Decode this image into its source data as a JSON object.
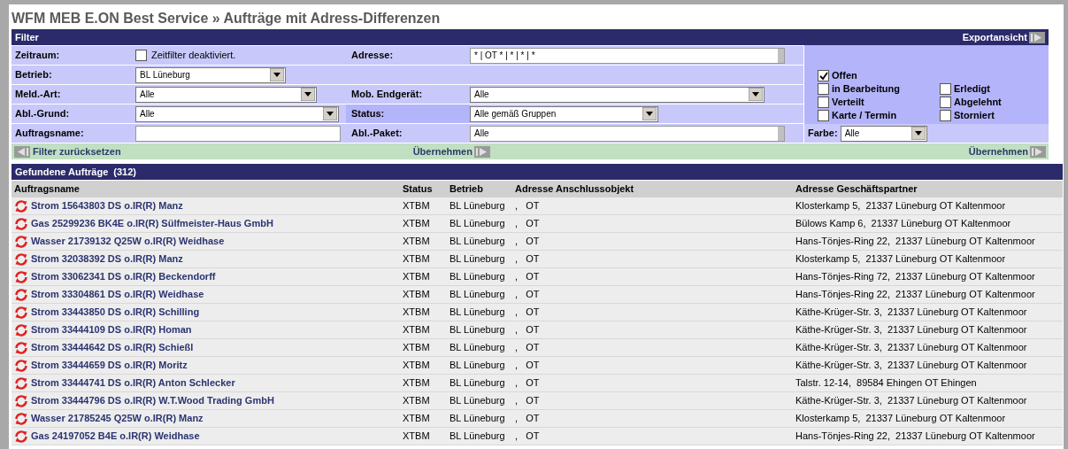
{
  "title": "WFM MEB E.ON Best Service » Aufträge mit Adress-Differenzen",
  "filter": {
    "heading": "Filter",
    "export_link": "Exportansicht",
    "rows": [
      {
        "label": "Zeitraum:",
        "control": {
          "kind": "checkbox",
          "checked": false,
          "label": "Zeitfilter deaktiviert."
        },
        "label2": "Adresse:",
        "control2": {
          "kind": "textarea",
          "value": "* | OT * | * | * | *"
        }
      },
      {
        "label": "Betrieb:",
        "control": {
          "kind": "select",
          "value": "BL Lüneburg"
        }
      },
      {
        "label": "Meld.-Art:",
        "control": {
          "kind": "select",
          "value": "Alle"
        },
        "label2": "Mob. Endgerät:",
        "control2": {
          "kind": "select",
          "value": "Alle"
        }
      },
      {
        "label": "Abl.-Grund:",
        "control": {
          "kind": "select",
          "value": "Alle"
        },
        "label2": "Status:",
        "control2": {
          "kind": "select",
          "value": "Alle gemäß Gruppen"
        }
      },
      {
        "label": "Auftragsname:",
        "control": {
          "kind": "text"
        },
        "label2": "Abl.-Paket:",
        "control2": {
          "kind": "textarea",
          "value": "Alle"
        }
      }
    ],
    "status_columns": [
      [
        {
          "label": "Offen",
          "checked": true
        },
        {
          "label": "in Bearbeitung",
          "checked": false
        },
        {
          "label": "Verteilt",
          "checked": false
        },
        {
          "label": "Karte / Termin",
          "checked": false
        }
      ],
      [
        {
          "label": "Erledigt",
          "checked": false
        },
        {
          "label": "Abgelehnt",
          "checked": false
        },
        {
          "label": "Storniert",
          "checked": false
        }
      ]
    ],
    "color_filter": {
      "label": "Farbe:",
      "value": "Alle"
    },
    "actions": {
      "reset": "Filter zurücksetzen",
      "apply": "Übernehmen",
      "apply_right": "Übernehmen"
    }
  },
  "results": {
    "heading": "Gefundene Aufträge",
    "count": "(312)",
    "columns": [
      "Auftragsname",
      "Status",
      "Betrieb",
      "Adresse Anschlussobjekt",
      "Adresse Geschäftspartner"
    ],
    "rows": [
      {
        "name": "Strom 15643803 DS o.IR(R) Manz",
        "status": "XTBM",
        "betrieb": "BL Lüneburg",
        "object": ",   OT",
        "partner": "Klosterkamp 5,  21337 Lüneburg OT Kaltenmoor"
      },
      {
        "name": "Gas 25299236 BK4E o.IR(R) Sülfmeister-Haus GmbH",
        "status": "XTBM",
        "betrieb": "BL Lüneburg",
        "object": ",   OT",
        "partner": "Bülows Kamp 6,  21337 Lüneburg OT Kaltenmoor"
      },
      {
        "name": "Wasser 21739132 Q25W o.IR(R) Weidhase",
        "status": "XTBM",
        "betrieb": "BL Lüneburg",
        "object": ",   OT",
        "partner": "Hans-Tönjes-Ring 22,  21337 Lüneburg OT Kaltenmoor"
      },
      {
        "name": "Strom 32038392 DS o.IR(R) Manz",
        "status": "XTBM",
        "betrieb": "BL Lüneburg",
        "object": ",   OT",
        "partner": "Klosterkamp 5,  21337 Lüneburg OT Kaltenmoor"
      },
      {
        "name": "Strom 33062341 DS o.IR(R) Beckendorff",
        "status": "XTBM",
        "betrieb": "BL Lüneburg",
        "object": ",   OT",
        "partner": "Hans-Tönjes-Ring 72,  21337 Lüneburg OT Kaltenmoor"
      },
      {
        "name": "Strom 33304861 DS o.IR(R) Weidhase",
        "status": "XTBM",
        "betrieb": "BL Lüneburg",
        "object": ",   OT",
        "partner": "Hans-Tönjes-Ring 22,  21337 Lüneburg OT Kaltenmoor"
      },
      {
        "name": "Strom 33443850 DS o.IR(R) Schilling",
        "status": "XTBM",
        "betrieb": "BL Lüneburg",
        "object": ",   OT",
        "partner": "Käthe-Krüger-Str. 3,  21337 Lüneburg OT Kaltenmoor"
      },
      {
        "name": "Strom 33444109 DS o.IR(R) Homan",
        "status": "XTBM",
        "betrieb": "BL Lüneburg",
        "object": ",   OT",
        "partner": "Käthe-Krüger-Str. 3,  21337 Lüneburg OT Kaltenmoor"
      },
      {
        "name": "Strom 33444642 DS o.IR(R) Schießl",
        "status": "XTBM",
        "betrieb": "BL Lüneburg",
        "object": ",   OT",
        "partner": "Käthe-Krüger-Str. 3,  21337 Lüneburg OT Kaltenmoor"
      },
      {
        "name": "Strom 33444659 DS o.IR(R) Moritz",
        "status": "XTBM",
        "betrieb": "BL Lüneburg",
        "object": ",   OT",
        "partner": "Käthe-Krüger-Str. 3,  21337 Lüneburg OT Kaltenmoor"
      },
      {
        "name": "Strom 33444741 DS o.IR(R) Anton Schlecker",
        "status": "XTBM",
        "betrieb": "BL Lüneburg",
        "object": ",   OT",
        "partner": "Talstr. 12-14,  89584 Ehingen OT Ehingen"
      },
      {
        "name": "Strom 33444796 DS o.IR(R) W.T.Wood Trading GmbH",
        "status": "XTBM",
        "betrieb": "BL Lüneburg",
        "object": ",   OT",
        "partner": "Käthe-Krüger-Str. 3,  21337 Lüneburg OT Kaltenmoor"
      },
      {
        "name": "Wasser 21785245 Q25W o.IR(R) Manz",
        "status": "XTBM",
        "betrieb": "BL Lüneburg",
        "object": ",   OT",
        "partner": "Klosterkamp 5,  21337 Lüneburg OT Kaltenmoor"
      },
      {
        "name": "Gas 24197052 B4E o.IR(R) Weidhase",
        "status": "XTBM",
        "betrieb": "BL Lüneburg",
        "object": ",   OT",
        "partner": "Hans-Tönjes-Ring 22,  21337 Lüneburg OT Kaltenmoor"
      }
    ]
  }
}
